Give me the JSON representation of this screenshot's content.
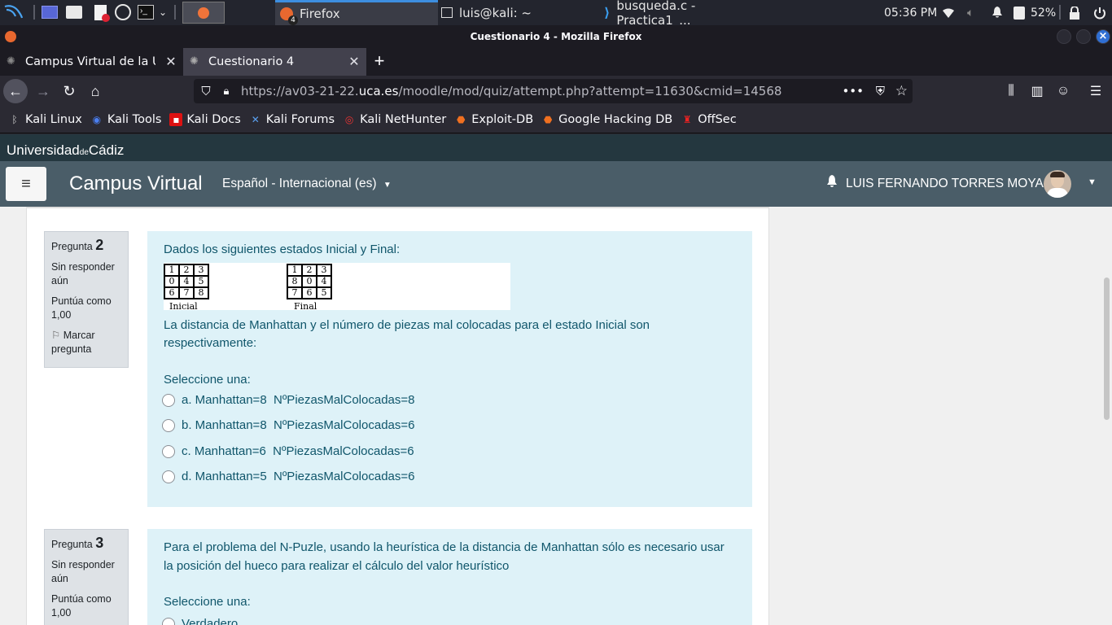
{
  "taskbar": {
    "windows": [
      {
        "label": "Firefox",
        "badge": "4"
      },
      {
        "label": "luis@kali: ~"
      },
      {
        "label": "busqueda.c - Practica1_..."
      }
    ],
    "clock": "05:36 PM",
    "battery": "52%"
  },
  "browser": {
    "window_title": "Cuestionario 4 - Mozilla Firefox",
    "tabs": [
      {
        "title": "Campus Virtual de la Univ"
      },
      {
        "title": "Cuestionario 4"
      }
    ],
    "url_prefix": "https://av03-21-22.",
    "url_host": "uca.es",
    "url_path": "/moodle/mod/quiz/attempt.php?attempt=11630&cmid=14568",
    "bookmarks": [
      "Kali Linux",
      "Kali Tools",
      "Kali Docs",
      "Kali Forums",
      "Kali NetHunter",
      "Exploit-DB",
      "Google Hacking DB",
      "OffSec"
    ]
  },
  "site": {
    "brand_main": "Universidad",
    "brand_de": "de",
    "brand_end": "Cádiz",
    "name": "Campus Virtual",
    "language": "Español - Internacional (es)",
    "user_name": "LUIS FERNANDO TORRES MOYA"
  },
  "questions": [
    {
      "label": "Pregunta",
      "number": "2",
      "status": "Sin responder aún",
      "score": "Puntúa como 1,00",
      "flag": "Marcar pregunta",
      "intro": "Dados los siguientes estados Inicial y Final:",
      "initial_grid": [
        "1",
        "2",
        "3",
        "0",
        "4",
        "5",
        "6",
        "7",
        "8"
      ],
      "initial_caption": "Inicial",
      "final_grid": [
        "1",
        "2",
        "3",
        "8",
        "0",
        "4",
        "7",
        "6",
        "5"
      ],
      "final_caption": "Final",
      "question": "La distancia de Manhattan y el número de piezas mal colocadas para el estado Inicial son respectivamente:",
      "prompt": "Seleccione una:",
      "options": [
        "a. Manhattan=8  NºPiezasMalColocadas=8",
        "b. Manhattan=8  NºPiezasMalColocadas=6",
        "c. Manhattan=6  NºPiezasMalColocadas=6",
        "d. Manhattan=5  NºPiezasMalColocadas=6"
      ]
    },
    {
      "label": "Pregunta",
      "number": "3",
      "status": "Sin responder aún",
      "score": "Puntúa como 1,00",
      "question": "Para el problema del N-Puzle, usando la heurística de la distancia de Manhattan sólo es necesario usar la posición del hueco para realizar el cálculo del valor heurístico",
      "prompt": "Seleccione una:",
      "options": [
        "Verdadero"
      ]
    }
  ]
}
